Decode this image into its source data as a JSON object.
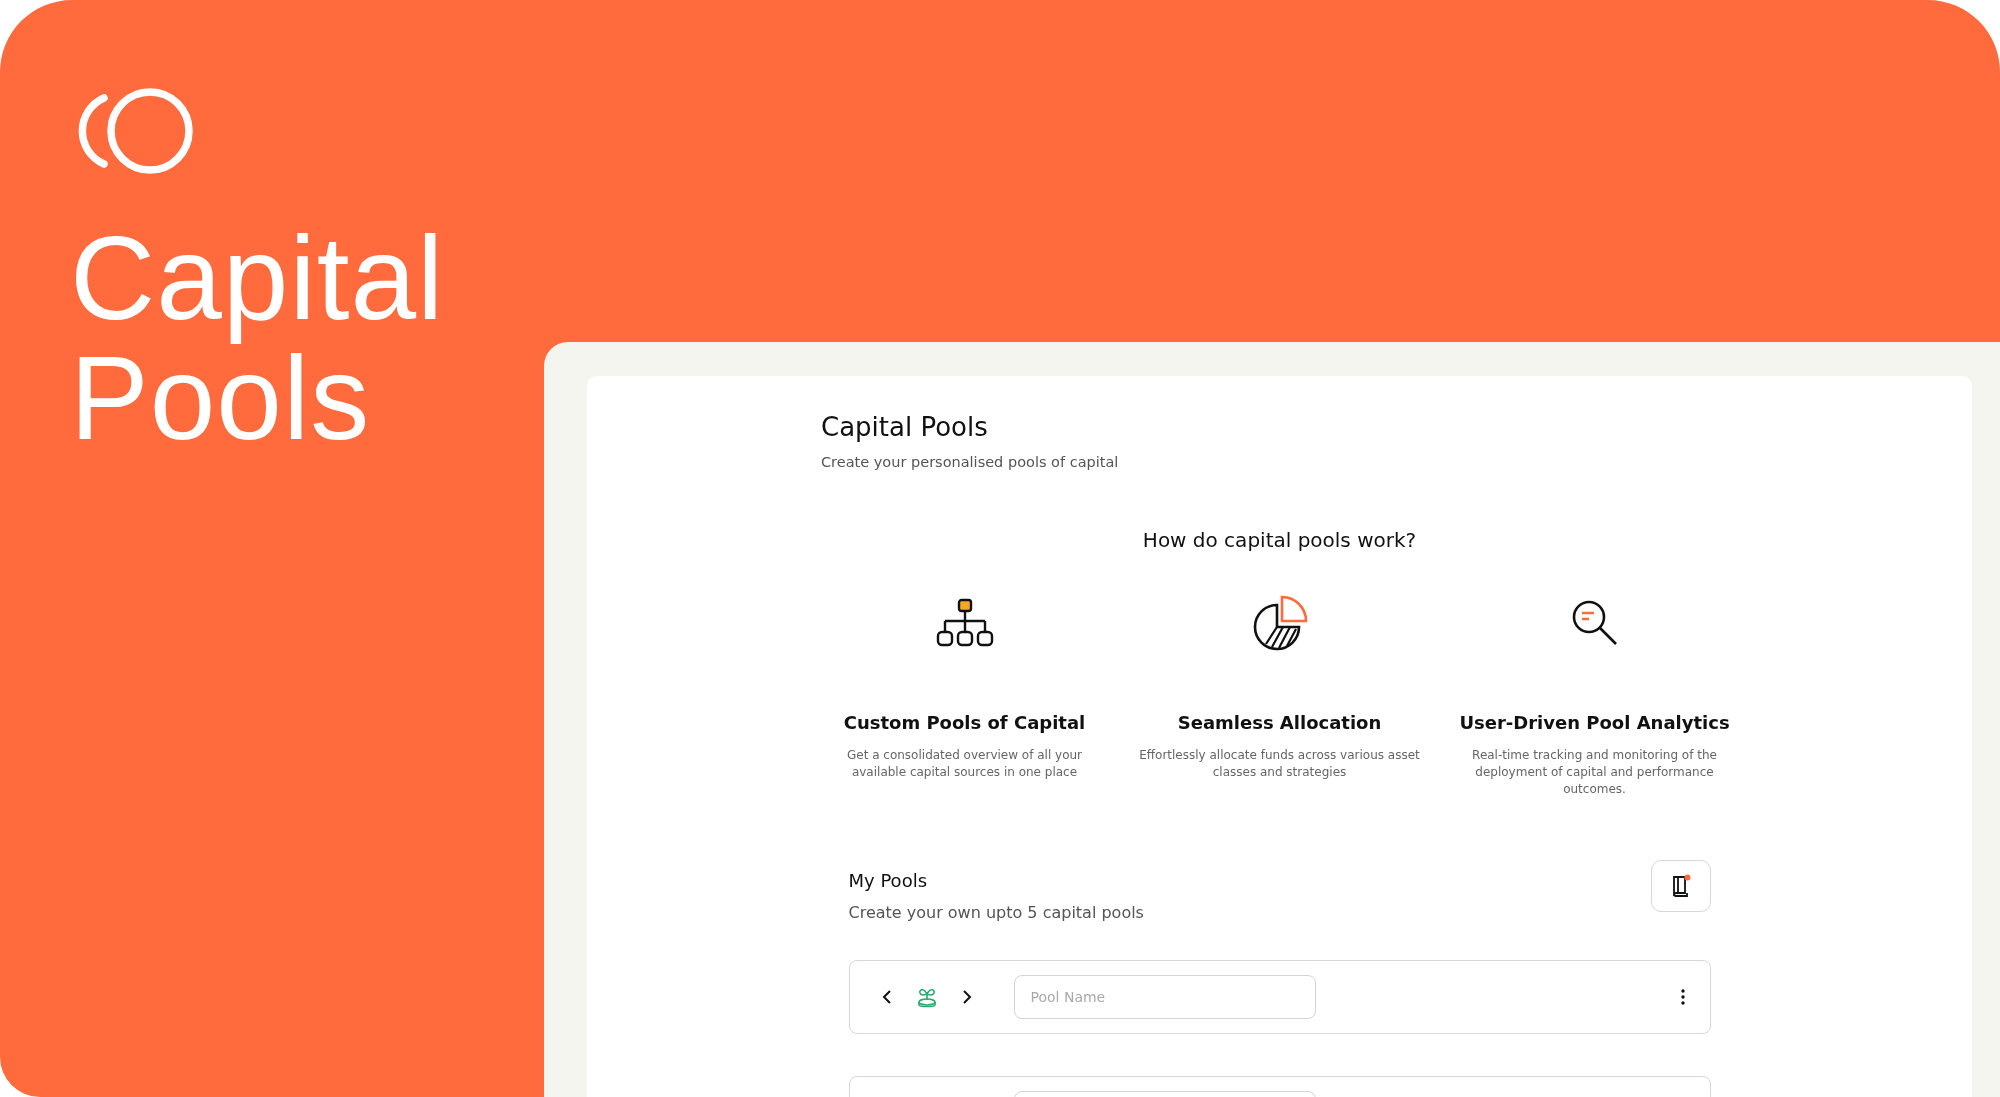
{
  "hero": {
    "title_lines": [
      "Capital",
      "Pools"
    ]
  },
  "page": {
    "title": "Capital Pools",
    "subtitle": "Create your personalised pools of capital"
  },
  "how_it_works": {
    "heading": "How do capital pools work?",
    "features": [
      {
        "kind": "hierarchy",
        "title": "Custom Pools of Capital",
        "description": "Get a consolidated overview of all your available capital sources in one place"
      },
      {
        "kind": "pie",
        "title": "Seamless Allocation",
        "description": "Effortlessly allocate funds across various asset classes and strategies"
      },
      {
        "kind": "search",
        "title": "User-Driven Pool Analytics",
        "description": "Real-time tracking and monitoring of the deployment of capital and performance outcomes."
      }
    ]
  },
  "my_pools": {
    "title": "My Pools",
    "subtitle": "Create your own upto 5 capital pools",
    "pools": [
      {
        "kind": "pool",
        "placeholder": "Pool Name"
      },
      {
        "kind": "pool"
      }
    ]
  }
}
